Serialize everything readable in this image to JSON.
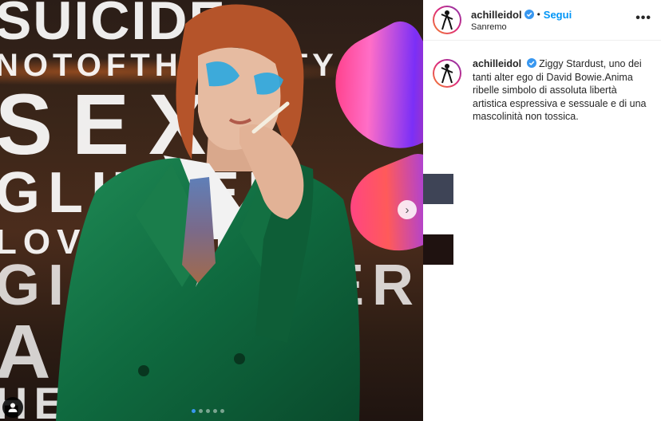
{
  "post": {
    "username": "achilleidol",
    "separator": "•",
    "follow_label": "Segui",
    "location": "Sanremo",
    "more_label": "•••",
    "caption_text": "Ziggy Stardust, uno dei tanti alter ego di David Bowie.Anima ribelle simbolo di assoluta libertà artistica espressiva e sessuale e di una mascolinità non tossica."
  },
  "media": {
    "background_lines": [
      "SUICIDE",
      "NOTOFTHEPARTY",
      "SEXY",
      "GLITTER",
      "LOVEMACHINE",
      "GIRLPOWER",
      "ALTER",
      "HEROES?"
    ],
    "carousel": {
      "total": 5,
      "active": 1
    },
    "next_icon": "chevron-right-icon",
    "tag_icon": "user-tag-icon"
  },
  "colors": {
    "accent": "#0095f6",
    "suit": "#0f6a3f",
    "swatch_1": "#3e4456",
    "swatch_2": "#1f1210"
  }
}
